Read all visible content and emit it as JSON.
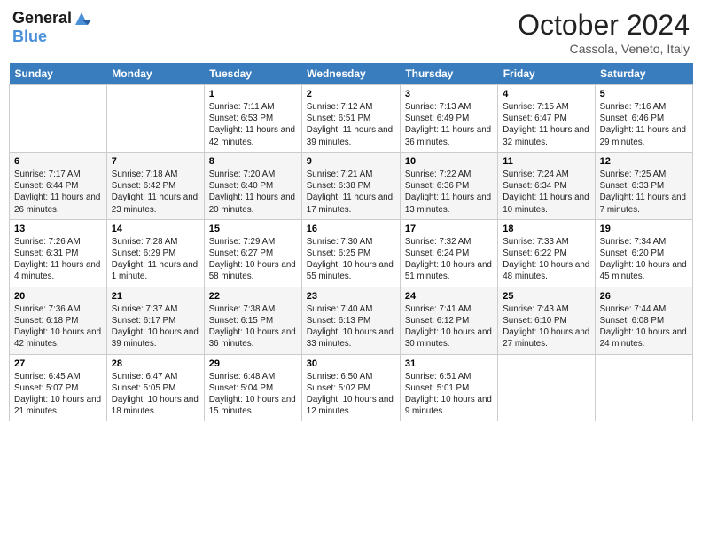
{
  "header": {
    "logo_line1": "General",
    "logo_line2": "Blue",
    "month": "October 2024",
    "location": "Cassola, Veneto, Italy"
  },
  "days_of_week": [
    "Sunday",
    "Monday",
    "Tuesday",
    "Wednesday",
    "Thursday",
    "Friday",
    "Saturday"
  ],
  "weeks": [
    [
      {
        "day": "",
        "content": ""
      },
      {
        "day": "",
        "content": ""
      },
      {
        "day": "1",
        "content": "Sunrise: 7:11 AM\nSunset: 6:53 PM\nDaylight: 11 hours and 42 minutes."
      },
      {
        "day": "2",
        "content": "Sunrise: 7:12 AM\nSunset: 6:51 PM\nDaylight: 11 hours and 39 minutes."
      },
      {
        "day": "3",
        "content": "Sunrise: 7:13 AM\nSunset: 6:49 PM\nDaylight: 11 hours and 36 minutes."
      },
      {
        "day": "4",
        "content": "Sunrise: 7:15 AM\nSunset: 6:47 PM\nDaylight: 11 hours and 32 minutes."
      },
      {
        "day": "5",
        "content": "Sunrise: 7:16 AM\nSunset: 6:46 PM\nDaylight: 11 hours and 29 minutes."
      }
    ],
    [
      {
        "day": "6",
        "content": "Sunrise: 7:17 AM\nSunset: 6:44 PM\nDaylight: 11 hours and 26 minutes."
      },
      {
        "day": "7",
        "content": "Sunrise: 7:18 AM\nSunset: 6:42 PM\nDaylight: 11 hours and 23 minutes."
      },
      {
        "day": "8",
        "content": "Sunrise: 7:20 AM\nSunset: 6:40 PM\nDaylight: 11 hours and 20 minutes."
      },
      {
        "day": "9",
        "content": "Sunrise: 7:21 AM\nSunset: 6:38 PM\nDaylight: 11 hours and 17 minutes."
      },
      {
        "day": "10",
        "content": "Sunrise: 7:22 AM\nSunset: 6:36 PM\nDaylight: 11 hours and 13 minutes."
      },
      {
        "day": "11",
        "content": "Sunrise: 7:24 AM\nSunset: 6:34 PM\nDaylight: 11 hours and 10 minutes."
      },
      {
        "day": "12",
        "content": "Sunrise: 7:25 AM\nSunset: 6:33 PM\nDaylight: 11 hours and 7 minutes."
      }
    ],
    [
      {
        "day": "13",
        "content": "Sunrise: 7:26 AM\nSunset: 6:31 PM\nDaylight: 11 hours and 4 minutes."
      },
      {
        "day": "14",
        "content": "Sunrise: 7:28 AM\nSunset: 6:29 PM\nDaylight: 11 hours and 1 minute."
      },
      {
        "day": "15",
        "content": "Sunrise: 7:29 AM\nSunset: 6:27 PM\nDaylight: 10 hours and 58 minutes."
      },
      {
        "day": "16",
        "content": "Sunrise: 7:30 AM\nSunset: 6:25 PM\nDaylight: 10 hours and 55 minutes."
      },
      {
        "day": "17",
        "content": "Sunrise: 7:32 AM\nSunset: 6:24 PM\nDaylight: 10 hours and 51 minutes."
      },
      {
        "day": "18",
        "content": "Sunrise: 7:33 AM\nSunset: 6:22 PM\nDaylight: 10 hours and 48 minutes."
      },
      {
        "day": "19",
        "content": "Sunrise: 7:34 AM\nSunset: 6:20 PM\nDaylight: 10 hours and 45 minutes."
      }
    ],
    [
      {
        "day": "20",
        "content": "Sunrise: 7:36 AM\nSunset: 6:18 PM\nDaylight: 10 hours and 42 minutes."
      },
      {
        "day": "21",
        "content": "Sunrise: 7:37 AM\nSunset: 6:17 PM\nDaylight: 10 hours and 39 minutes."
      },
      {
        "day": "22",
        "content": "Sunrise: 7:38 AM\nSunset: 6:15 PM\nDaylight: 10 hours and 36 minutes."
      },
      {
        "day": "23",
        "content": "Sunrise: 7:40 AM\nSunset: 6:13 PM\nDaylight: 10 hours and 33 minutes."
      },
      {
        "day": "24",
        "content": "Sunrise: 7:41 AM\nSunset: 6:12 PM\nDaylight: 10 hours and 30 minutes."
      },
      {
        "day": "25",
        "content": "Sunrise: 7:43 AM\nSunset: 6:10 PM\nDaylight: 10 hours and 27 minutes."
      },
      {
        "day": "26",
        "content": "Sunrise: 7:44 AM\nSunset: 6:08 PM\nDaylight: 10 hours and 24 minutes."
      }
    ],
    [
      {
        "day": "27",
        "content": "Sunrise: 6:45 AM\nSunset: 5:07 PM\nDaylight: 10 hours and 21 minutes."
      },
      {
        "day": "28",
        "content": "Sunrise: 6:47 AM\nSunset: 5:05 PM\nDaylight: 10 hours and 18 minutes."
      },
      {
        "day": "29",
        "content": "Sunrise: 6:48 AM\nSunset: 5:04 PM\nDaylight: 10 hours and 15 minutes."
      },
      {
        "day": "30",
        "content": "Sunrise: 6:50 AM\nSunset: 5:02 PM\nDaylight: 10 hours and 12 minutes."
      },
      {
        "day": "31",
        "content": "Sunrise: 6:51 AM\nSunset: 5:01 PM\nDaylight: 10 hours and 9 minutes."
      },
      {
        "day": "",
        "content": ""
      },
      {
        "day": "",
        "content": ""
      }
    ]
  ]
}
